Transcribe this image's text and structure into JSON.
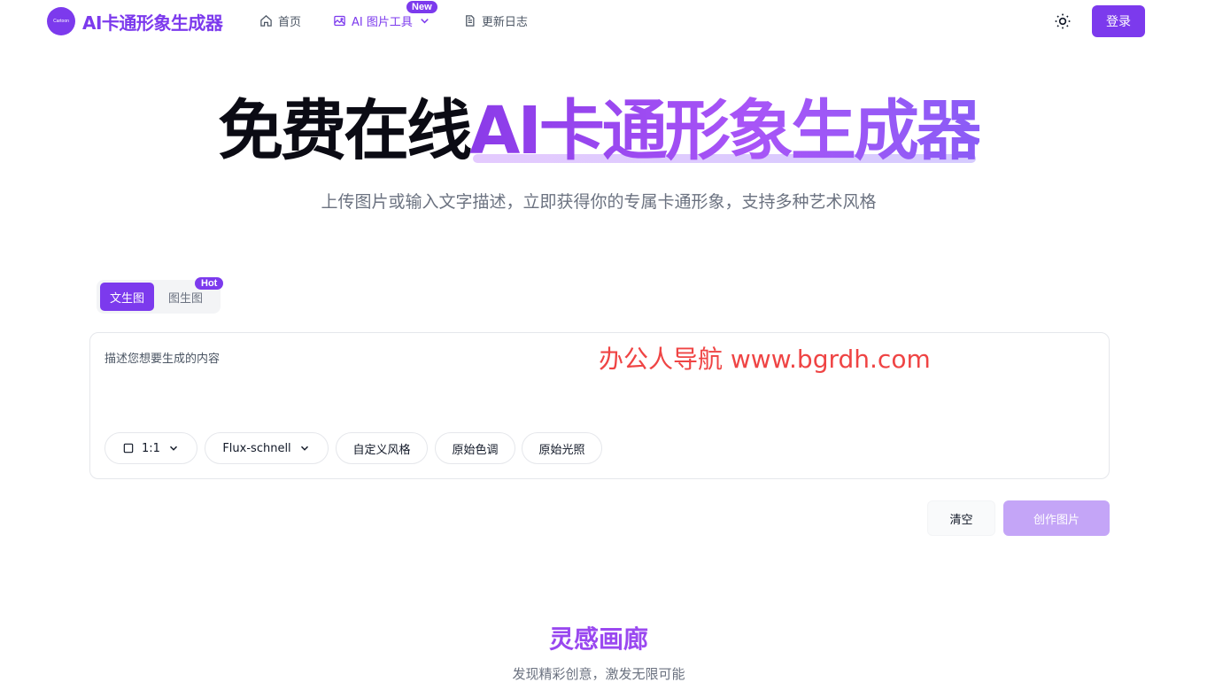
{
  "header": {
    "logo_mark": "Cartoon",
    "logo_text": "AI卡通形象生成器",
    "nav": [
      {
        "label": "首页",
        "icon": "home-icon"
      },
      {
        "label": "AI 图片工具",
        "icon": "image-icon",
        "badge": "New"
      },
      {
        "label": "更新日志",
        "icon": "document-icon"
      }
    ],
    "theme_icon": "sun-icon",
    "login_label": "登录"
  },
  "hero": {
    "title_plain": "免费在线",
    "title_highlight": "AI卡通形象生成器",
    "subtitle": "上传图片或输入文字描述，立即获得你的专属卡通形象，支持多种艺术风格"
  },
  "tabs": {
    "items": [
      "文生图",
      "图生图"
    ],
    "active": "文生图",
    "hot_badge": "Hot"
  },
  "prompt": {
    "placeholder": "描述您想要生成的内容",
    "watermark": "办公人导航  www.bgrdh.com"
  },
  "options": {
    "ratio": "1:1",
    "model": "Flux-schnell",
    "style": "自定义风格",
    "color": "原始色调",
    "lighting": "原始光照"
  },
  "actions": {
    "clear": "清空",
    "create": "创作图片"
  },
  "gallery": {
    "title": "灵感画廊",
    "subtitle": "发现精彩创意，激发无限可能"
  },
  "colors": {
    "brand": "#7c3aed",
    "create_disabled": "#c4a5f7",
    "watermark": "#ef4444"
  }
}
